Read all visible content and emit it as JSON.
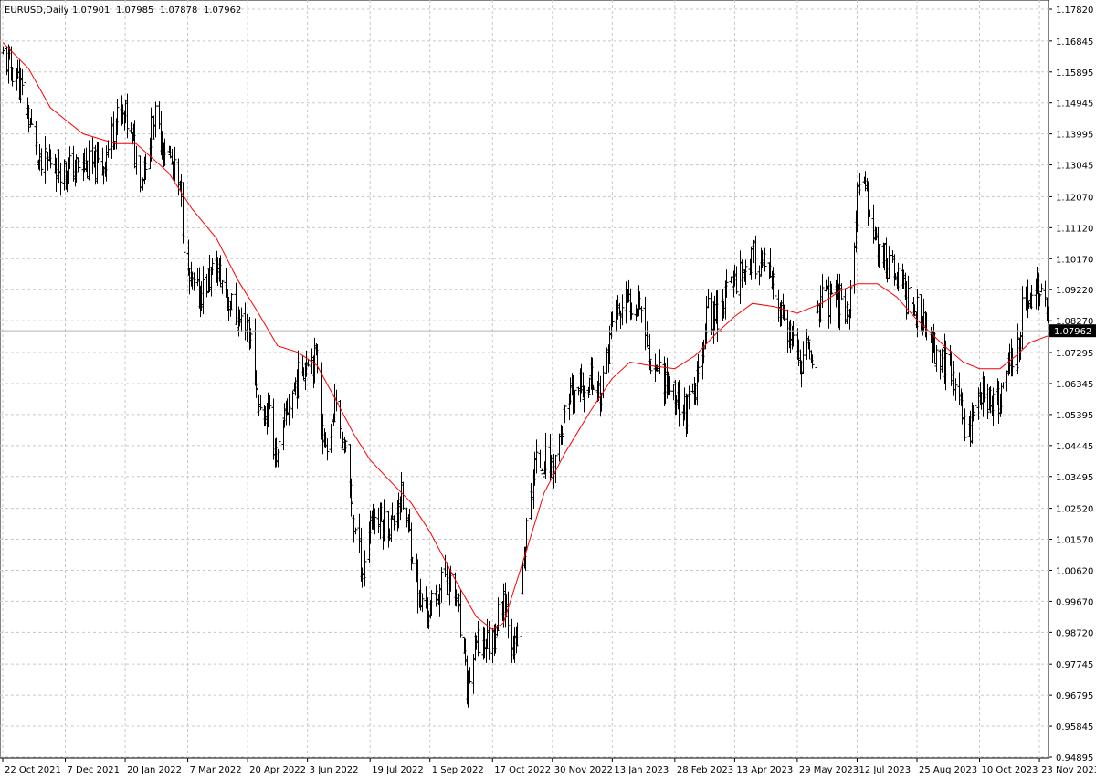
{
  "header": {
    "symbol_label": "EURUSD,Daily",
    "ohlc_open": "1.07901",
    "ohlc_high": "1.07985",
    "ohlc_low": "1.07878",
    "ohlc_close": "1.07962"
  },
  "current_price": {
    "value": 1.07962,
    "label": "1.07962"
  },
  "colors": {
    "background": "#ffffff",
    "bars": "#000000",
    "moving_average": "#ff0000",
    "grid": "#c8c8c8",
    "price_tag_bg": "#000000",
    "price_line": "#b4b4b4"
  },
  "chart_data": {
    "type": "line",
    "title": "",
    "style": "ohlc-bars with moving average",
    "grid": true,
    "x_axis": {
      "type": "date",
      "tick_labels": [
        "22 Oct 2021",
        "7 Dec 2021",
        "20 Jan 2022",
        "7 Mar 2022",
        "20 Apr 2022",
        "3 Jun 2022",
        "19 Jul 2022",
        "1 Sep 2022",
        "17 Oct 2022",
        "30 Nov 2022",
        "13 Jan 2023",
        "28 Feb 2023",
        "13 Apr 2023",
        "29 May 2023",
        "12 Jul 2023",
        "25 Aug 2023",
        "10 Oct 2023",
        "23 Nov 2023"
      ],
      "range": [
        "2021-10-22",
        "2023-11-29"
      ]
    },
    "y_axis": {
      "tick_labels": [
        "1.17820",
        "1.16845",
        "1.15895",
        "1.14945",
        "1.13995",
        "1.13045",
        "1.12070",
        "1.11120",
        "1.10170",
        "1.09220",
        "1.08270",
        "1.07295",
        "1.06345",
        "1.05395",
        "1.04445",
        "1.03495",
        "1.02520",
        "1.01570",
        "1.00620",
        "0.99670",
        "0.98720",
        "0.97745",
        "0.96795",
        "0.95845",
        "0.94895"
      ],
      "ylim": [
        0.94895,
        1.1782
      ]
    },
    "series": [
      {
        "name": "",
        "kind": "price",
        "x": [
          "2021-10-22",
          "2021-11-01",
          "2021-11-10",
          "2021-11-18",
          "2021-11-26",
          "2021-12-07",
          "2021-12-20",
          "2022-01-03",
          "2022-01-13",
          "2022-01-20",
          "2022-02-01",
          "2022-02-10",
          "2022-02-21",
          "2022-03-01",
          "2022-03-07",
          "2022-03-14",
          "2022-03-28",
          "2022-04-05",
          "2022-04-13",
          "2022-04-20",
          "2022-04-28",
          "2022-05-05",
          "2022-05-12",
          "2022-05-20",
          "2022-05-27",
          "2022-06-03",
          "2022-06-10",
          "2022-06-15",
          "2022-06-23",
          "2022-06-30",
          "2022-07-07",
          "2022-07-14",
          "2022-07-19",
          "2022-07-27",
          "2022-08-04",
          "2022-08-10",
          "2022-08-18",
          "2022-08-24",
          "2022-09-01",
          "2022-09-12",
          "2022-09-20",
          "2022-09-28",
          "2022-10-05",
          "2022-10-17",
          "2022-10-25",
          "2022-11-03",
          "2022-11-10",
          "2022-11-17",
          "2022-11-24",
          "2022-11-30",
          "2022-12-09",
          "2022-12-15",
          "2022-12-28",
          "2023-01-05",
          "2023-01-13",
          "2023-01-26",
          "2023-02-02",
          "2023-02-09",
          "2023-02-17",
          "2023-02-28",
          "2023-03-08",
          "2023-03-15",
          "2023-03-23",
          "2023-03-31",
          "2023-04-13",
          "2023-04-26",
          "2023-05-04",
          "2023-05-12",
          "2023-05-22",
          "2023-05-29",
          "2023-06-09",
          "2023-06-16",
          "2023-06-23",
          "2023-06-30",
          "2023-07-06",
          "2023-07-12",
          "2023-07-18",
          "2023-07-27",
          "2023-08-04",
          "2023-08-10",
          "2023-08-17",
          "2023-08-25",
          "2023-09-06",
          "2023-09-14",
          "2023-09-21",
          "2023-09-28",
          "2023-10-03",
          "2023-10-10",
          "2023-10-18",
          "2023-10-25",
          "2023-11-01",
          "2023-11-06",
          "2023-11-10",
          "2023-11-16",
          "2023-11-21",
          "2023-11-23",
          "2023-11-29"
        ],
        "values": [
          1.164,
          1.158,
          1.145,
          1.129,
          1.132,
          1.129,
          1.13,
          1.13,
          1.144,
          1.145,
          1.127,
          1.145,
          1.133,
          1.122,
          1.095,
          1.09,
          1.099,
          1.09,
          1.082,
          1.083,
          1.055,
          1.054,
          1.04,
          1.058,
          1.065,
          1.073,
          1.07,
          1.044,
          1.055,
          1.045,
          1.02,
          1.005,
          1.023,
          1.021,
          1.02,
          1.03,
          1.015,
          0.996,
          0.994,
          1.005,
          0.998,
          0.97,
          0.983,
          0.985,
          0.999,
          0.98,
          1.015,
          1.038,
          1.04,
          1.038,
          1.053,
          1.06,
          1.065,
          1.06,
          1.083,
          1.088,
          1.09,
          1.072,
          1.068,
          1.06,
          1.055,
          1.06,
          1.085,
          1.085,
          1.096,
          1.102,
          1.1,
          1.09,
          1.078,
          1.07,
          1.074,
          1.092,
          1.087,
          1.09,
          1.085,
          1.12,
          1.123,
          1.105,
          1.1,
          1.096,
          1.09,
          1.085,
          1.075,
          1.07,
          1.064,
          1.052,
          1.05,
          1.062,
          1.058,
          1.057,
          1.07,
          1.073,
          1.085,
          1.09,
          1.093,
          1.095,
          1.0796
        ]
      },
      {
        "name": "",
        "kind": "moving-average",
        "x": [
          "2021-10-22",
          "2021-11-10",
          "2021-11-26",
          "2021-12-20",
          "2022-01-13",
          "2022-01-28",
          "2022-02-21",
          "2022-03-10",
          "2022-03-28",
          "2022-04-13",
          "2022-04-28",
          "2022-05-12",
          "2022-05-27",
          "2022-06-10",
          "2022-06-23",
          "2022-07-07",
          "2022-07-19",
          "2022-08-04",
          "2022-08-18",
          "2022-09-01",
          "2022-09-20",
          "2022-10-05",
          "2022-10-17",
          "2022-10-25",
          "2022-11-10",
          "2022-11-24",
          "2022-12-09",
          "2022-12-28",
          "2023-01-13",
          "2023-01-26",
          "2023-02-09",
          "2023-02-28",
          "2023-03-15",
          "2023-03-31",
          "2023-04-13",
          "2023-04-26",
          "2023-05-12",
          "2023-05-29",
          "2023-06-16",
          "2023-06-30",
          "2023-07-12",
          "2023-07-27",
          "2023-08-10",
          "2023-08-25",
          "2023-09-14",
          "2023-09-28",
          "2023-10-10",
          "2023-10-25",
          "2023-11-06",
          "2023-11-16",
          "2023-11-29"
        ],
        "values": [
          1.168,
          1.16,
          1.148,
          1.14,
          1.137,
          1.137,
          1.128,
          1.117,
          1.108,
          1.095,
          1.085,
          1.075,
          1.073,
          1.069,
          1.059,
          1.048,
          1.04,
          1.033,
          1.027,
          1.018,
          1.003,
          0.992,
          0.988,
          0.99,
          1.011,
          1.03,
          1.042,
          1.055,
          1.065,
          1.07,
          1.069,
          1.068,
          1.072,
          1.079,
          1.084,
          1.088,
          1.087,
          1.085,
          1.088,
          1.092,
          1.094,
          1.094,
          1.09,
          1.083,
          1.075,
          1.07,
          1.068,
          1.068,
          1.072,
          1.076,
          1.078
        ]
      }
    ]
  }
}
